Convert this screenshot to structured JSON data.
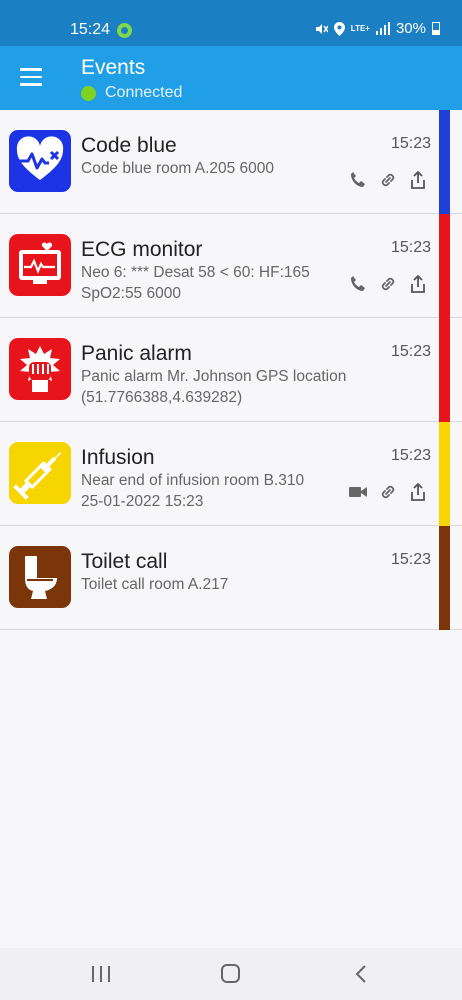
{
  "status": {
    "time": "15:24",
    "battery": "30%",
    "network": "LTE+"
  },
  "appbar": {
    "title": "Events",
    "connection": "Connected",
    "connection_color": "#7ed321"
  },
  "events": [
    {
      "title": "Code blue",
      "line1": "Code blue room A.205 6000",
      "line2": "",
      "time": "15:23",
      "stripe_color": "#1f3fd6",
      "icon": "heart-monitor-icon",
      "actions": [
        "phone-icon",
        "link-icon",
        "share-icon"
      ]
    },
    {
      "title": "ECG monitor",
      "line1": "Neo 6: *** Desat 58 < 60: HF:165",
      "line2": "SpO2:55 6000",
      "time": "15:23",
      "stripe_color": "#e8141b",
      "icon": "ecg-monitor-icon",
      "actions": [
        "phone-icon",
        "link-icon",
        "share-icon"
      ]
    },
    {
      "title": "Panic alarm",
      "line1": "Panic alarm Mr. Johnson GPS location",
      "line2": "(51.7766388,4.639282)",
      "time": "15:23",
      "stripe_color": "#e8141b",
      "icon": "fist-icon",
      "actions": []
    },
    {
      "title": "Infusion",
      "line1": "Near end of infusion room B.310",
      "line2": "25-01-2022 15:23",
      "time": "15:23",
      "stripe_color": "#f6d500",
      "icon": "syringe-icon",
      "actions": [
        "video-icon",
        "link-icon",
        "share-icon"
      ]
    },
    {
      "title": "Toilet call",
      "line1": "Toilet call room A.217",
      "line2": "",
      "time": "15:23",
      "stripe_color": "#7a3608",
      "icon": "toilet-icon",
      "actions": []
    }
  ]
}
